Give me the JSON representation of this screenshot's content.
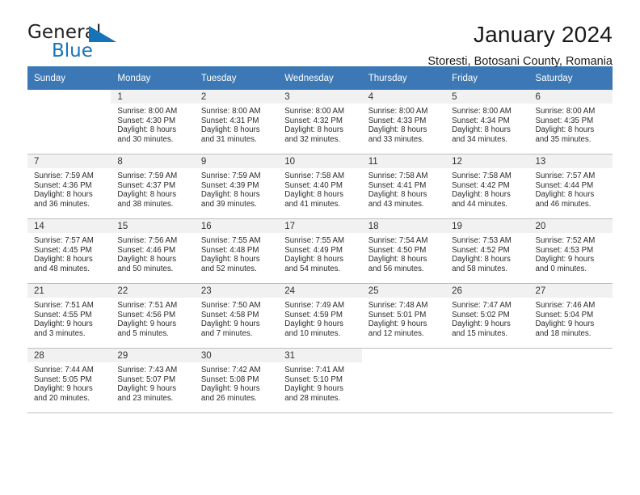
{
  "brand": {
    "name_part1": "General",
    "name_part2": "Blue",
    "accent_color": "#1573ba"
  },
  "header": {
    "title": "January 2024",
    "subtitle": "Storesti, Botosani County, Romania"
  },
  "calendar": {
    "header_bg": "#3b78b5",
    "weekdays": [
      "Sunday",
      "Monday",
      "Tuesday",
      "Wednesday",
      "Thursday",
      "Friday",
      "Saturday"
    ],
    "weeks": [
      [
        {
          "date": "",
          "empty": true
        },
        {
          "date": "1",
          "sunrise": "Sunrise: 8:00 AM",
          "sunset": "Sunset: 4:30 PM",
          "daylight1": "Daylight: 8 hours",
          "daylight2": "and 30 minutes."
        },
        {
          "date": "2",
          "sunrise": "Sunrise: 8:00 AM",
          "sunset": "Sunset: 4:31 PM",
          "daylight1": "Daylight: 8 hours",
          "daylight2": "and 31 minutes."
        },
        {
          "date": "3",
          "sunrise": "Sunrise: 8:00 AM",
          "sunset": "Sunset: 4:32 PM",
          "daylight1": "Daylight: 8 hours",
          "daylight2": "and 32 minutes."
        },
        {
          "date": "4",
          "sunrise": "Sunrise: 8:00 AM",
          "sunset": "Sunset: 4:33 PM",
          "daylight1": "Daylight: 8 hours",
          "daylight2": "and 33 minutes."
        },
        {
          "date": "5",
          "sunrise": "Sunrise: 8:00 AM",
          "sunset": "Sunset: 4:34 PM",
          "daylight1": "Daylight: 8 hours",
          "daylight2": "and 34 minutes."
        },
        {
          "date": "6",
          "sunrise": "Sunrise: 8:00 AM",
          "sunset": "Sunset: 4:35 PM",
          "daylight1": "Daylight: 8 hours",
          "daylight2": "and 35 minutes."
        }
      ],
      [
        {
          "date": "7",
          "sunrise": "Sunrise: 7:59 AM",
          "sunset": "Sunset: 4:36 PM",
          "daylight1": "Daylight: 8 hours",
          "daylight2": "and 36 minutes."
        },
        {
          "date": "8",
          "sunrise": "Sunrise: 7:59 AM",
          "sunset": "Sunset: 4:37 PM",
          "daylight1": "Daylight: 8 hours",
          "daylight2": "and 38 minutes."
        },
        {
          "date": "9",
          "sunrise": "Sunrise: 7:59 AM",
          "sunset": "Sunset: 4:39 PM",
          "daylight1": "Daylight: 8 hours",
          "daylight2": "and 39 minutes."
        },
        {
          "date": "10",
          "sunrise": "Sunrise: 7:58 AM",
          "sunset": "Sunset: 4:40 PM",
          "daylight1": "Daylight: 8 hours",
          "daylight2": "and 41 minutes."
        },
        {
          "date": "11",
          "sunrise": "Sunrise: 7:58 AM",
          "sunset": "Sunset: 4:41 PM",
          "daylight1": "Daylight: 8 hours",
          "daylight2": "and 43 minutes."
        },
        {
          "date": "12",
          "sunrise": "Sunrise: 7:58 AM",
          "sunset": "Sunset: 4:42 PM",
          "daylight1": "Daylight: 8 hours",
          "daylight2": "and 44 minutes."
        },
        {
          "date": "13",
          "sunrise": "Sunrise: 7:57 AM",
          "sunset": "Sunset: 4:44 PM",
          "daylight1": "Daylight: 8 hours",
          "daylight2": "and 46 minutes."
        }
      ],
      [
        {
          "date": "14",
          "sunrise": "Sunrise: 7:57 AM",
          "sunset": "Sunset: 4:45 PM",
          "daylight1": "Daylight: 8 hours",
          "daylight2": "and 48 minutes."
        },
        {
          "date": "15",
          "sunrise": "Sunrise: 7:56 AM",
          "sunset": "Sunset: 4:46 PM",
          "daylight1": "Daylight: 8 hours",
          "daylight2": "and 50 minutes."
        },
        {
          "date": "16",
          "sunrise": "Sunrise: 7:55 AM",
          "sunset": "Sunset: 4:48 PM",
          "daylight1": "Daylight: 8 hours",
          "daylight2": "and 52 minutes."
        },
        {
          "date": "17",
          "sunrise": "Sunrise: 7:55 AM",
          "sunset": "Sunset: 4:49 PM",
          "daylight1": "Daylight: 8 hours",
          "daylight2": "and 54 minutes."
        },
        {
          "date": "18",
          "sunrise": "Sunrise: 7:54 AM",
          "sunset": "Sunset: 4:50 PM",
          "daylight1": "Daylight: 8 hours",
          "daylight2": "and 56 minutes."
        },
        {
          "date": "19",
          "sunrise": "Sunrise: 7:53 AM",
          "sunset": "Sunset: 4:52 PM",
          "daylight1": "Daylight: 8 hours",
          "daylight2": "and 58 minutes."
        },
        {
          "date": "20",
          "sunrise": "Sunrise: 7:52 AM",
          "sunset": "Sunset: 4:53 PM",
          "daylight1": "Daylight: 9 hours",
          "daylight2": "and 0 minutes."
        }
      ],
      [
        {
          "date": "21",
          "sunrise": "Sunrise: 7:51 AM",
          "sunset": "Sunset: 4:55 PM",
          "daylight1": "Daylight: 9 hours",
          "daylight2": "and 3 minutes."
        },
        {
          "date": "22",
          "sunrise": "Sunrise: 7:51 AM",
          "sunset": "Sunset: 4:56 PM",
          "daylight1": "Daylight: 9 hours",
          "daylight2": "and 5 minutes."
        },
        {
          "date": "23",
          "sunrise": "Sunrise: 7:50 AM",
          "sunset": "Sunset: 4:58 PM",
          "daylight1": "Daylight: 9 hours",
          "daylight2": "and 7 minutes."
        },
        {
          "date": "24",
          "sunrise": "Sunrise: 7:49 AM",
          "sunset": "Sunset: 4:59 PM",
          "daylight1": "Daylight: 9 hours",
          "daylight2": "and 10 minutes."
        },
        {
          "date": "25",
          "sunrise": "Sunrise: 7:48 AM",
          "sunset": "Sunset: 5:01 PM",
          "daylight1": "Daylight: 9 hours",
          "daylight2": "and 12 minutes."
        },
        {
          "date": "26",
          "sunrise": "Sunrise: 7:47 AM",
          "sunset": "Sunset: 5:02 PM",
          "daylight1": "Daylight: 9 hours",
          "daylight2": "and 15 minutes."
        },
        {
          "date": "27",
          "sunrise": "Sunrise: 7:46 AM",
          "sunset": "Sunset: 5:04 PM",
          "daylight1": "Daylight: 9 hours",
          "daylight2": "and 18 minutes."
        }
      ],
      [
        {
          "date": "28",
          "sunrise": "Sunrise: 7:44 AM",
          "sunset": "Sunset: 5:05 PM",
          "daylight1": "Daylight: 9 hours",
          "daylight2": "and 20 minutes."
        },
        {
          "date": "29",
          "sunrise": "Sunrise: 7:43 AM",
          "sunset": "Sunset: 5:07 PM",
          "daylight1": "Daylight: 9 hours",
          "daylight2": "and 23 minutes."
        },
        {
          "date": "30",
          "sunrise": "Sunrise: 7:42 AM",
          "sunset": "Sunset: 5:08 PM",
          "daylight1": "Daylight: 9 hours",
          "daylight2": "and 26 minutes."
        },
        {
          "date": "31",
          "sunrise": "Sunrise: 7:41 AM",
          "sunset": "Sunset: 5:10 PM",
          "daylight1": "Daylight: 9 hours",
          "daylight2": "and 28 minutes."
        },
        {
          "date": "",
          "empty": true
        },
        {
          "date": "",
          "empty": true
        },
        {
          "date": "",
          "empty": true
        }
      ]
    ]
  }
}
